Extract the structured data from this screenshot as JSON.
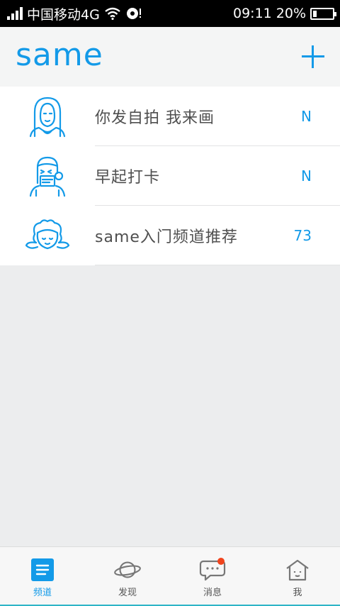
{
  "status": {
    "carrier": "中国移动4G",
    "time": "09:11",
    "battery": "20%",
    "battery_level": 0.2
  },
  "header": {
    "logo": "same"
  },
  "channels": [
    {
      "name": "你发自拍 我来画",
      "count": "N",
      "icon": "mona-lisa-icon"
    },
    {
      "name": "早起打卡",
      "count": "N",
      "icon": "sleepy-person-icon"
    },
    {
      "name": "same入门频道推荐",
      "count": "73",
      "icon": "curly-hair-angel-icon"
    }
  ],
  "tabs": [
    {
      "label": "频道",
      "icon": "document-icon",
      "active": true
    },
    {
      "label": "发现",
      "icon": "planet-icon",
      "active": false
    },
    {
      "label": "消息",
      "icon": "chat-bubble-icon",
      "active": false,
      "badge": true
    },
    {
      "label": "我",
      "icon": "house-icon",
      "active": false
    }
  ],
  "colors": {
    "accent": "#139ae8",
    "badge": "#f1441d",
    "background": "#ecedee"
  }
}
